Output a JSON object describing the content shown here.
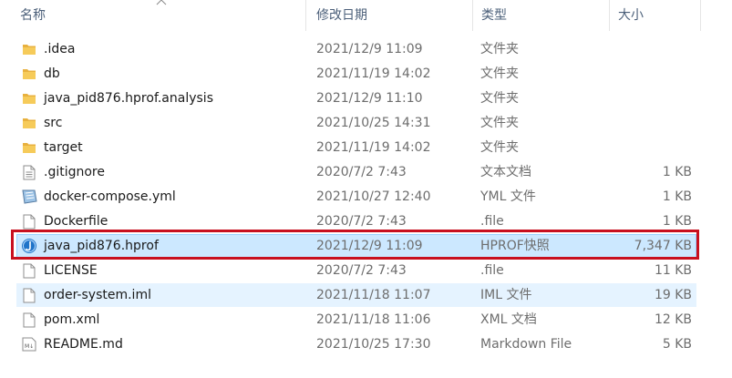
{
  "columns": {
    "name": "名称",
    "date": "修改日期",
    "type": "类型",
    "size": "大小"
  },
  "files": [
    {
      "name": ".idea",
      "date": "2021/12/9 11:09",
      "type": "文件夹",
      "size": "",
      "icon": "folder-icon"
    },
    {
      "name": "db",
      "date": "2021/11/19 14:02",
      "type": "文件夹",
      "size": "",
      "icon": "folder-icon"
    },
    {
      "name": "java_pid876.hprof.analysis",
      "date": "2021/12/9 11:10",
      "type": "文件夹",
      "size": "",
      "icon": "folder-icon"
    },
    {
      "name": "src",
      "date": "2021/10/25 14:31",
      "type": "文件夹",
      "size": "",
      "icon": "folder-icon"
    },
    {
      "name": "target",
      "date": "2021/11/19 14:02",
      "type": "文件夹",
      "size": "",
      "icon": "folder-icon"
    },
    {
      "name": ".gitignore",
      "date": "2020/7/2 7:43",
      "type": "文本文档",
      "size": "1 KB",
      "icon": "text-file-icon"
    },
    {
      "name": "docker-compose.yml",
      "date": "2021/10/27 12:40",
      "type": "YML 文件",
      "size": "1 KB",
      "icon": "yml-file-icon"
    },
    {
      "name": "Dockerfile",
      "date": "2020/7/2 7:43",
      "type": ".file",
      "size": "1 KB",
      "icon": "blank-file-icon"
    },
    {
      "name": "java_pid876.hprof",
      "date": "2021/12/9 11:09",
      "type": "HPROF快照",
      "size": "7,347 KB",
      "icon": "hprof-file-icon"
    },
    {
      "name": "LICENSE",
      "date": "2020/7/2 7:43",
      "type": ".file",
      "size": "11 KB",
      "icon": "blank-file-icon"
    },
    {
      "name": "order-system.iml",
      "date": "2021/11/18 11:07",
      "type": "IML 文件",
      "size": "19 KB",
      "icon": "blank-file-icon"
    },
    {
      "name": "pom.xml",
      "date": "2021/11/18 11:06",
      "type": "XML 文档",
      "size": "12 KB",
      "icon": "blank-file-icon"
    },
    {
      "name": "README.md",
      "date": "2021/10/25 17:30",
      "type": "Markdown File",
      "size": "5 KB",
      "icon": "markdown-file-icon"
    }
  ],
  "selected_file": "java_pid876.hprof",
  "hovered_file": "order-system.iml",
  "colors": {
    "folder": "#e8b13f",
    "selection": "#cce8ff",
    "hover": "#e5f3ff",
    "annotation": "#c8101f"
  }
}
